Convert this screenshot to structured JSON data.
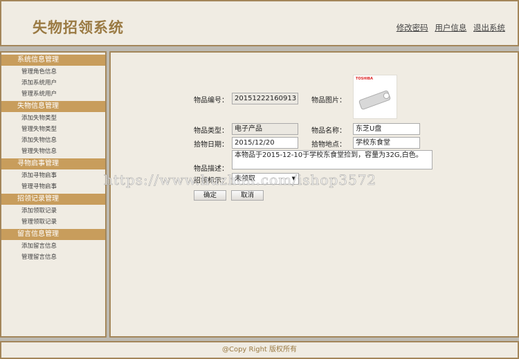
{
  "header": {
    "title": "失物招领系统",
    "links": [
      "修改密码",
      "用户信息",
      "退出系统"
    ]
  },
  "sidebar": [
    {
      "title": "系统信息管理",
      "items": [
        "管理角色信息",
        "添加系统用户",
        "管理系统用户"
      ]
    },
    {
      "title": "失物信息管理",
      "items": [
        "添加失物类型",
        "管理失物类型",
        "添加失物信息",
        "管理失物信息"
      ]
    },
    {
      "title": "寻物启事管理",
      "items": [
        "添加寻物启事",
        "管理寻物启事"
      ]
    },
    {
      "title": "招领记录管理",
      "items": [
        "添加领取记录",
        "管理领取记录"
      ]
    },
    {
      "title": "留言信息管理",
      "items": [
        "添加留言信息",
        "管理留言信息"
      ]
    }
  ],
  "form": {
    "id_label": "物品编号：",
    "id_value": "20151222160913",
    "image_label": "物品图片：",
    "image_brand": "TOSHIBA",
    "type_label": "物品类型：",
    "type_value": "电子产品",
    "name_label": "物品名称：",
    "name_value": "东芝U盘",
    "date_label": "拾物日期：",
    "date_value": "2015/12/20",
    "place_label": "拾物地点：",
    "place_value": "学校东食堂",
    "desc_label": "物品描述：",
    "desc_value": "本物品于2015-12-10于学校东食堂捡到，容量为32G,白色。",
    "status_label": "招领标示：",
    "status_value": "未领取",
    "ok_label": "确定",
    "cancel_label": "取消"
  },
  "watermark": "https://www.huzhan.com/ishop3572",
  "footer": "@Copy Right 版权所有"
}
